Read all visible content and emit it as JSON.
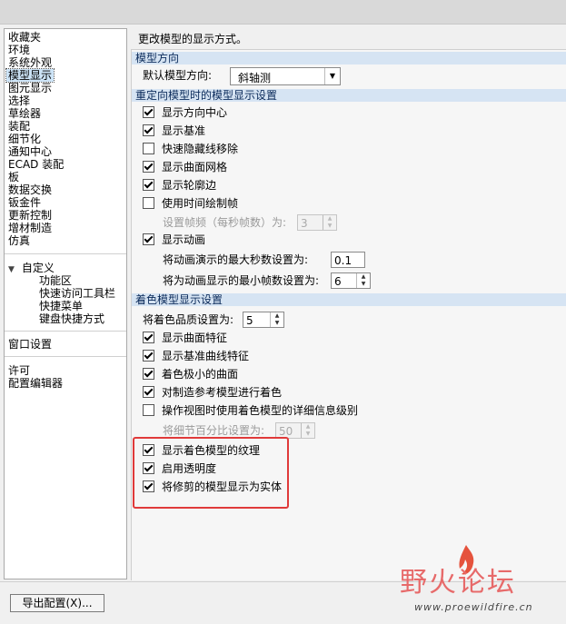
{
  "nav": {
    "items": [
      "收藏夹",
      "环境",
      "系统外观",
      "模型显示",
      "图元显示",
      "选择",
      "草绘器",
      "装配",
      "细节化",
      "通知中心",
      "ECAD 装配",
      "板",
      "数据交换",
      "钣金件",
      "更新控制",
      "增材制造",
      "仿真"
    ],
    "selected": "模型显示",
    "customize": "自定义",
    "customize_items": [
      "功能区",
      "快速访问工具栏",
      "快捷菜单",
      "键盘快捷方式"
    ],
    "window_settings": "窗口设置",
    "license": "许可",
    "config_editor": "配置编辑器"
  },
  "main": {
    "description": "更改模型的显示方式。",
    "sections": {
      "orientation": "模型方向",
      "reorient": "重定向模型时的模型显示设置",
      "shaded": "着色模型显示设置"
    },
    "orientation": {
      "label": "默认模型方向:",
      "value": "斜轴测"
    },
    "reorient_options": [
      {
        "label": "显示方向中心",
        "checked": true
      },
      {
        "label": "显示基准",
        "checked": true
      },
      {
        "label": "快速隐藏线移除",
        "checked": false
      },
      {
        "label": "显示曲面网格",
        "checked": true
      },
      {
        "label": "显示轮廓边",
        "checked": true
      },
      {
        "label": "使用时间绘制帧",
        "checked": false
      }
    ],
    "frame_rate": {
      "label": "设置帧频（每秒帧数）为:",
      "value": "3"
    },
    "animation": {
      "label": "显示动画",
      "checked": true
    },
    "anim_max_seconds": {
      "label": "将动画演示的最大秒数设置为:",
      "value": "0.1"
    },
    "anim_min_frames": {
      "label": "将为动画显示的最小帧数设置为:",
      "value": "6"
    },
    "shade_quality": {
      "label": "将着色品质设置为:",
      "value": "5"
    },
    "shaded_options": [
      {
        "label": "显示曲面特征",
        "checked": true
      },
      {
        "label": "显示基准曲线特征",
        "checked": true
      },
      {
        "label": "着色极小的曲面",
        "checked": true
      },
      {
        "label": "对制造参考模型进行着色",
        "checked": true
      },
      {
        "label": "操作视图时使用着色模型的详细信息级别",
        "checked": false
      }
    ],
    "detail_percent": {
      "label": "将细节百分比设置为:",
      "value": "50"
    },
    "highlighted_options": [
      {
        "label": "显示着色模型的纹理",
        "checked": true
      },
      {
        "label": "启用透明度",
        "checked": true
      },
      {
        "label": "将修剪的模型显示为实体",
        "checked": true
      }
    ]
  },
  "footer": {
    "export_button": "导出配置(X)..."
  },
  "watermark": {
    "title": "野火论坛",
    "url": "www.proewildfire.cn"
  },
  "colors": {
    "section_bg": "#d6e4f3",
    "highlight_box": "#e03a3a",
    "selection": "#cde4f7"
  }
}
